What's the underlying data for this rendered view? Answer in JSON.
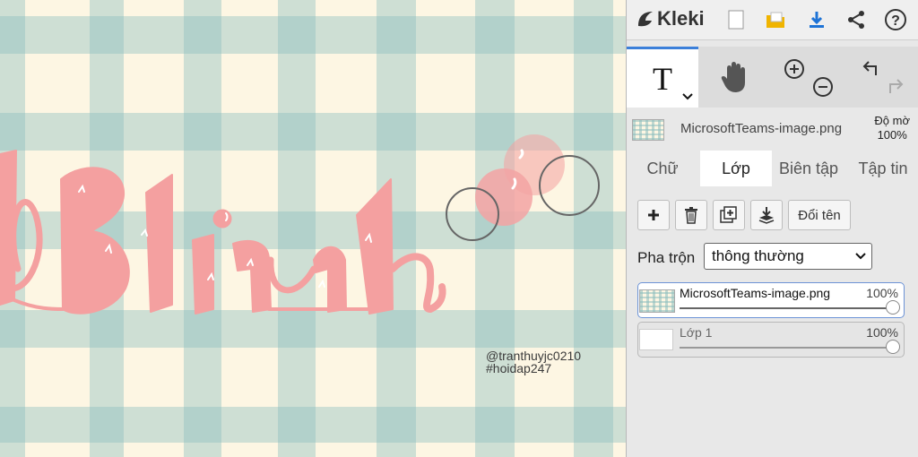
{
  "app": {
    "name": "Kleki"
  },
  "topbar": {
    "icons": [
      "new-image-icon",
      "open-folder-icon",
      "download-icon",
      "share-icon",
      "help-icon"
    ]
  },
  "tools": {
    "text_tool_glyph": "T",
    "icons": [
      "text-tool-icon",
      "hand-tool-icon",
      "zoom-in-icon",
      "zoom-out-icon",
      "undo-icon",
      "redo-icon"
    ]
  },
  "layer_info": {
    "name": "MicrosoftTeams-image.png",
    "opacity_label": "Độ mờ",
    "opacity_value": "100%"
  },
  "tabs": [
    {
      "label": "Chữ",
      "active": false
    },
    {
      "label": "Lớp",
      "active": true
    },
    {
      "label": "Biên tập",
      "active": false
    },
    {
      "label": "Tập tin",
      "active": false
    }
  ],
  "layer_buttons": {
    "icons": [
      "add-layer-icon",
      "delete-layer-icon",
      "duplicate-layer-icon",
      "merge-layer-icon"
    ],
    "rename_label": "Đổi tên"
  },
  "blend": {
    "label": "Pha trộn",
    "value": "thông thường"
  },
  "layers": [
    {
      "name": "MicrosoftTeams-image.png",
      "opacity": "100%",
      "opacity_fraction": 1.0,
      "selected": true
    },
    {
      "name": "Lớp 1",
      "opacity": "100%",
      "opacity_fraction": 1.0,
      "selected": false
    }
  ],
  "canvas": {
    "watermark_line1": "@tranthuyjc0210",
    "watermark_line2": "#hoidap247",
    "colors": {
      "background": "#fdf6e3",
      "gingham": "#8cbebe",
      "lettering": "#f4a0a0"
    }
  }
}
